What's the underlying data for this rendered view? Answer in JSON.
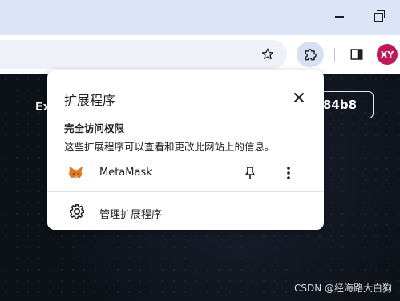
{
  "window": {
    "minimize_icon": "minimize-icon",
    "restore_icon": "restore-icon"
  },
  "toolbar": {
    "bookmark_icon": "star-icon",
    "extensions_icon": "puzzle-icon",
    "sidepanel_icon": "side-panel-icon",
    "avatar_initials": "XY",
    "avatar_color": "#c2185b"
  },
  "page": {
    "left_text": "Ex",
    "address_fragment": "84b8",
    "watermark": "CSDN @经海路大白狗"
  },
  "popup": {
    "title": "扩展程序",
    "close_icon": "close-icon",
    "section_heading": "完全访问权限",
    "section_desc": "这些扩展程序可以查看和更改此网站上的信息。",
    "extensions": [
      {
        "name": "MetaMask",
        "icon": "metamask-fox-icon",
        "pin_icon": "pin-icon",
        "more_icon": "more-vert-icon"
      }
    ],
    "manage_label": "管理扩展程序",
    "manage_icon": "gear-icon"
  }
}
